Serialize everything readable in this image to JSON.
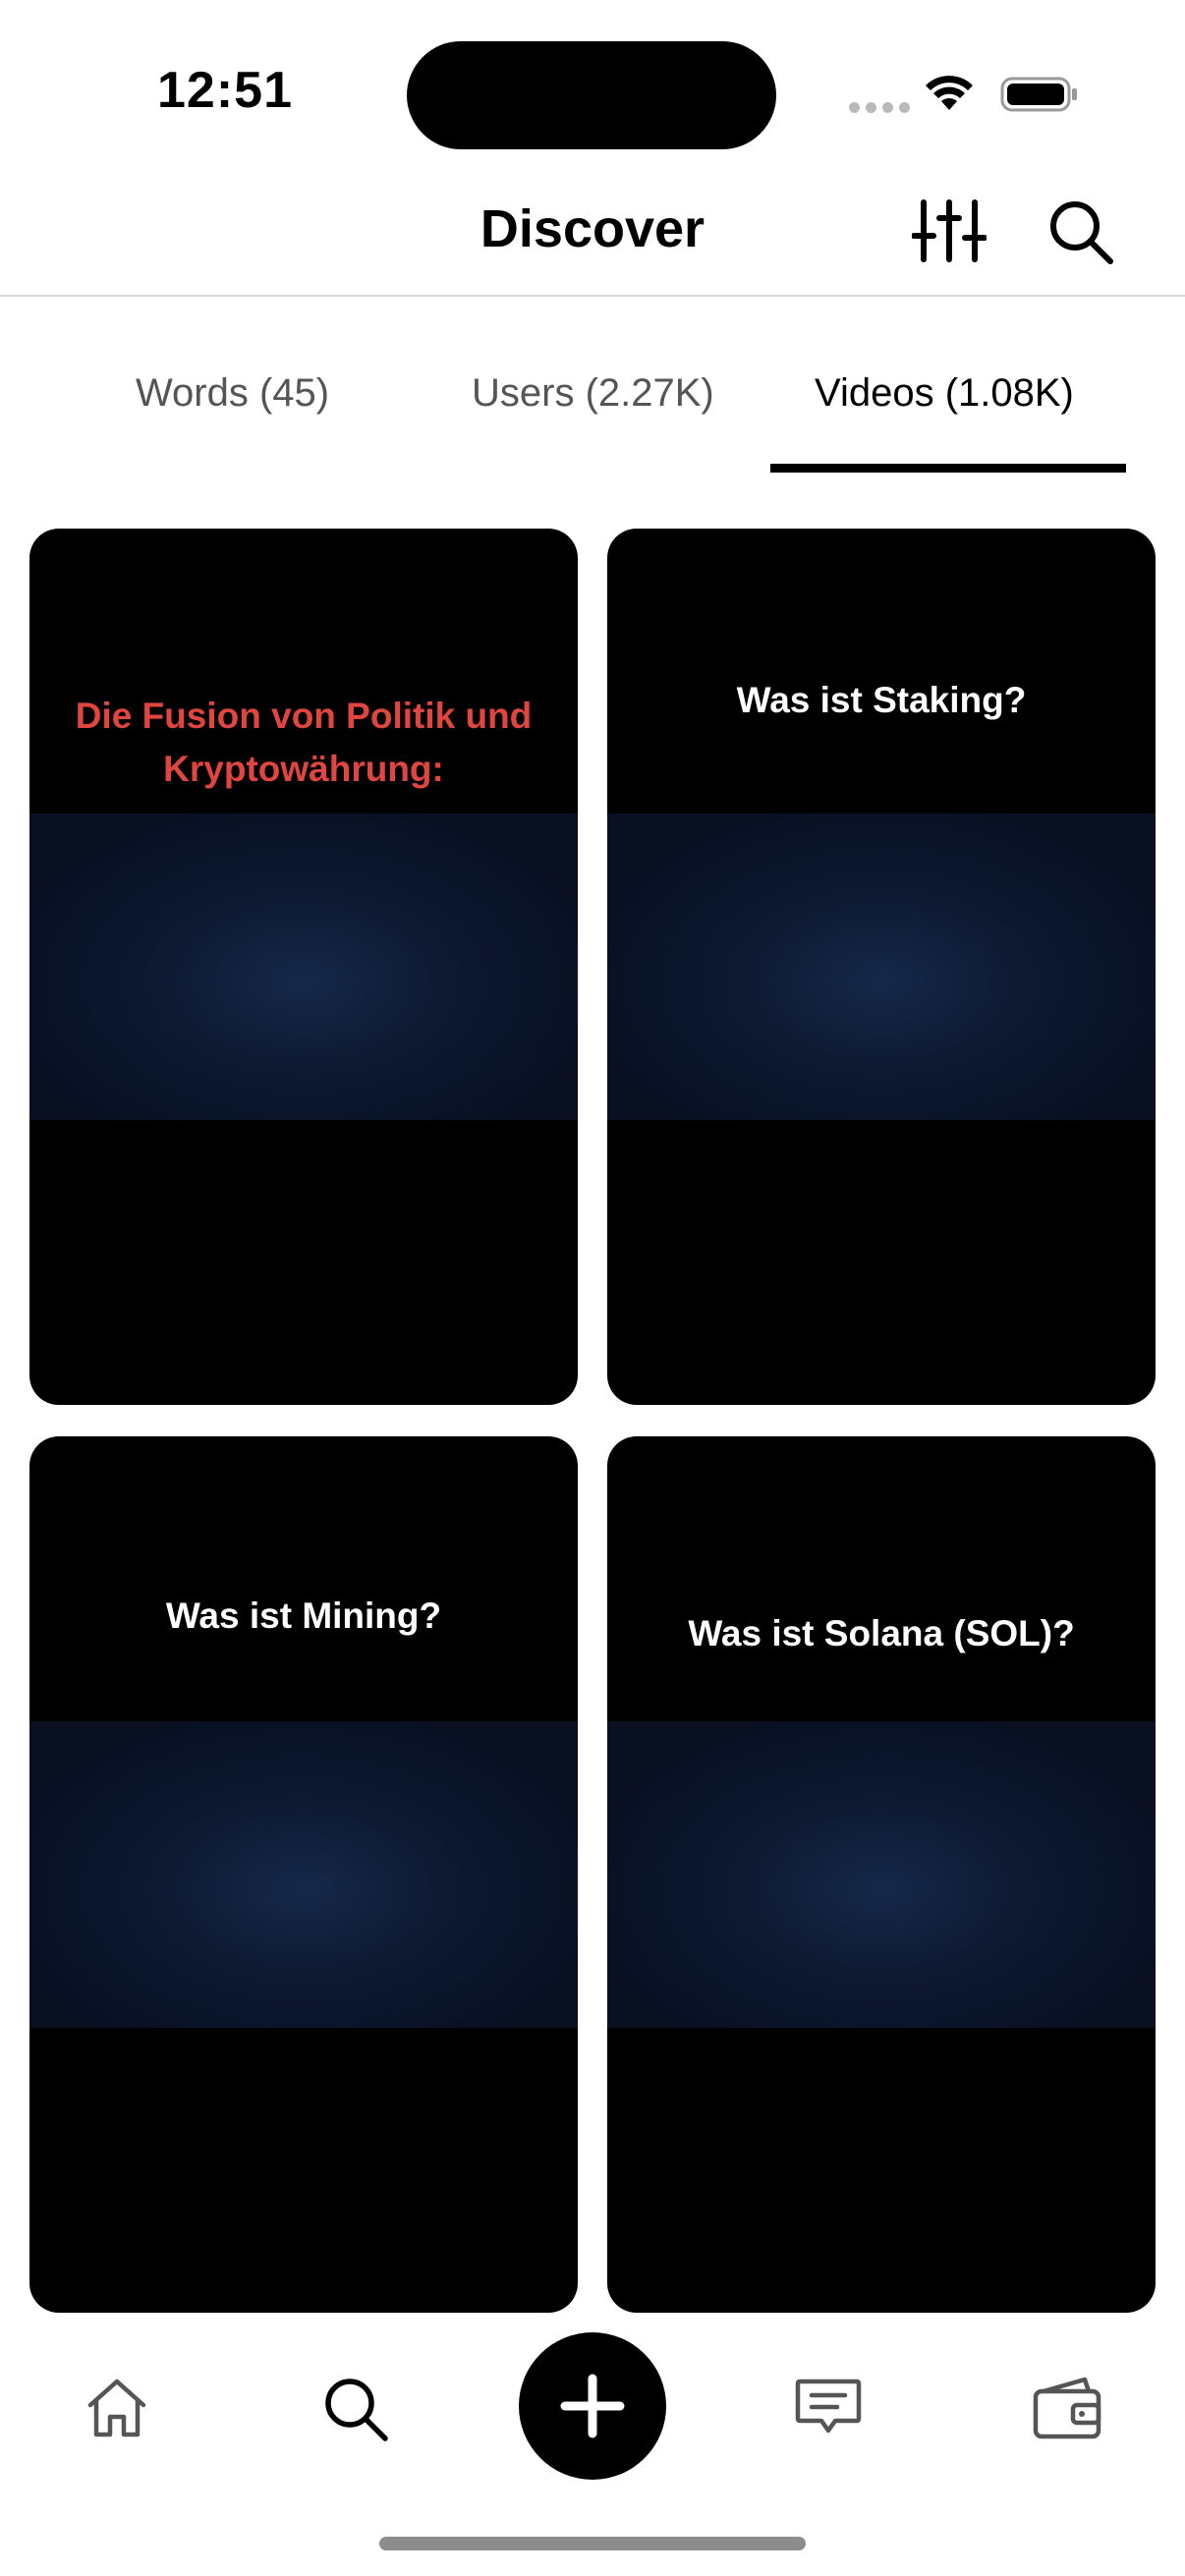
{
  "status_bar": {
    "time": "12:51"
  },
  "header": {
    "title": "Discover",
    "filter_icon": "sliders-icon",
    "search_icon": "search-icon"
  },
  "tabs": [
    {
      "label": "Words (45)",
      "active": false
    },
    {
      "label": "Users (2.27K)",
      "active": false
    },
    {
      "label": "Videos (1.08K)",
      "active": true
    }
  ],
  "videos": [
    {
      "caption": "Die Fusion von Politik und Kryptowährung:",
      "caption_color": "#e0453f"
    },
    {
      "caption": "Was ist Staking?",
      "caption_color": "#ffffff"
    },
    {
      "caption": "Was ist Mining?",
      "caption_color": "#ffffff"
    },
    {
      "caption": "Was ist Solana (SOL)?",
      "caption_color": "#ffffff"
    }
  ],
  "bottom_nav": [
    {
      "icon": "home-icon"
    },
    {
      "icon": "search-icon"
    },
    {
      "icon": "plus-icon"
    },
    {
      "icon": "message-icon"
    },
    {
      "icon": "wallet-icon"
    }
  ]
}
